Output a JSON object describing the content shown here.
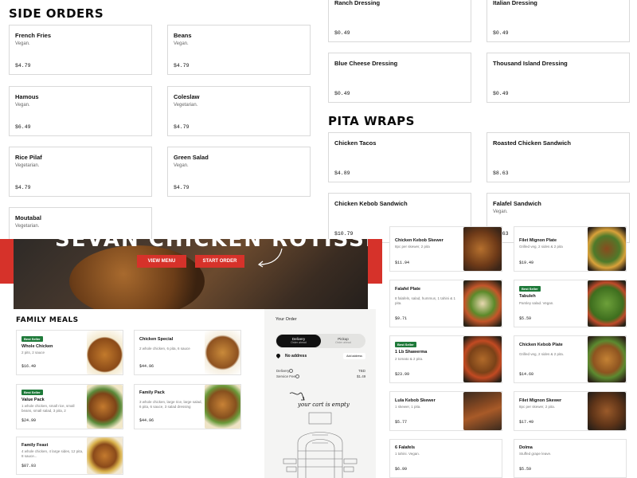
{
  "side_orders": {
    "title": "SIDE ORDERS",
    "items": [
      {
        "name": "French Fries",
        "desc": "Vegan.",
        "price": "$4.79"
      },
      {
        "name": "Beans",
        "desc": "Vegan.",
        "price": "$4.79"
      },
      {
        "name": "Hamous",
        "desc": "Vegan.",
        "price": "$6.49"
      },
      {
        "name": "Coleslaw",
        "desc": "Vegetarian.",
        "price": "$4.79"
      },
      {
        "name": "Rice Pilaf",
        "desc": "Vegetarian.",
        "price": "$4.79"
      },
      {
        "name": "Green Salad",
        "desc": "Vegan.",
        "price": "$4.79"
      },
      {
        "name": "Moutabal",
        "desc": "Vegetarian.",
        "price": ""
      }
    ]
  },
  "dressings": [
    {
      "name": "Ranch Dressing",
      "price": "$0.49"
    },
    {
      "name": "Italian Dressing",
      "price": "$0.49"
    },
    {
      "name": "Blue Cheese Dressing",
      "price": "$0.49"
    },
    {
      "name": "Thousand Island Dressing",
      "price": "$0.49"
    }
  ],
  "pita_wraps": {
    "title": "PITA WRAPS",
    "items": [
      {
        "name": "Chicken Tacos",
        "desc": "",
        "price": "$4.89"
      },
      {
        "name": "Roasted Chicken Sandwich",
        "desc": "",
        "price": "$8.63"
      },
      {
        "name": "Chicken Kebob Sandwich",
        "desc": "",
        "price": "$10.79"
      },
      {
        "name": "Falafel Sandwich",
        "desc": "Vegan.",
        "price": "$8.63"
      }
    ]
  },
  "hero": {
    "title_fragment": "SEVAN CHICKEN ROTISSERIE",
    "view_menu": "VIEW MENU",
    "start_order": "START ORDER"
  },
  "family_meals": {
    "title": "FAMILY MEALS",
    "items": [
      {
        "name": "Whole Chicken",
        "desc": "2 pits, 2 sauce",
        "price": "$16.49",
        "badge": "Best Seller"
      },
      {
        "name": "Chicken Special",
        "desc": "2 whole chicken, 6 pita, 6 sauce",
        "price": "$44.96",
        "badge": ""
      },
      {
        "name": "Value Pack",
        "desc": "1 whole chicken, small rice, small beans, small salad, 3 pita, 2 sauce...",
        "price": "$24.99",
        "badge": "Best Seller"
      },
      {
        "name": "Family Pack",
        "desc": "3 whole chicken, large rice, large salad, 6 pita, 6 sauce, 3 salad dressing",
        "price": "$44.96",
        "badge": ""
      },
      {
        "name": "Family Feast",
        "desc": "4 whole chicken, 4 large sides, 12 pita, 8 sauce...",
        "price": "$87.93",
        "badge": ""
      }
    ]
  },
  "cart": {
    "title": "Your Order",
    "delivery_label": "Delivery",
    "delivery_sub": "Order ahead",
    "pickup_label": "Pickup",
    "pickup_sub": "Order ahead",
    "no_address": "No address",
    "add_address": "Add address",
    "delivery_row": "Delivery",
    "delivery_value": "TBD",
    "service_fee": "Service Fee",
    "service_value": "$1.49",
    "empty_text": "your cart is empty"
  },
  "right_menu": [
    {
      "name": "Chicken Kebob Skewer",
      "desc": "8pc per skewer, 2 pita",
      "price": "$11.94",
      "badge": ""
    },
    {
      "name": "Filet Mignon Plate",
      "desc": "Grilled veg, 2 sides & 2 pita",
      "price": "$19.49",
      "badge": ""
    },
    {
      "name": "Falafel Plate",
      "desc": "8 falafels, salad, hummus, 1 tahini & 1 pita.",
      "price": "$9.71",
      "badge": ""
    },
    {
      "name": "Tabuleh",
      "desc": "Parsley salad. Vegan.",
      "price": "$5.59",
      "badge": "Best Seller"
    },
    {
      "name": "1 Lb Shawerma",
      "desc": "2 tomato & 2 pita.",
      "price": "$23.99",
      "badge": "Best Seller"
    },
    {
      "name": "Chicken Kebob Plate",
      "desc": "Grilled veg, 2 sides & 2 pita.",
      "price": "$14.60",
      "badge": ""
    },
    {
      "name": "Lula Kebob Skewer",
      "desc": "1 skewer, 1 pita.",
      "price": "$5.77",
      "badge": ""
    },
    {
      "name": "Filet Mignon Skewer",
      "desc": "8pc per skewer, 2 pita.",
      "price": "$17.49",
      "badge": ""
    },
    {
      "name": "6 Falafels",
      "desc": "1 tahini. Vegan.",
      "price": "$6.99",
      "badge": ""
    },
    {
      "name": "Dolma",
      "desc": "Stuffed grape leave.",
      "price": "$5.59",
      "badge": ""
    }
  ],
  "colors": {
    "brand_red": "#d6322a",
    "badge_green": "#1f7a3a",
    "dark": "#111111"
  }
}
